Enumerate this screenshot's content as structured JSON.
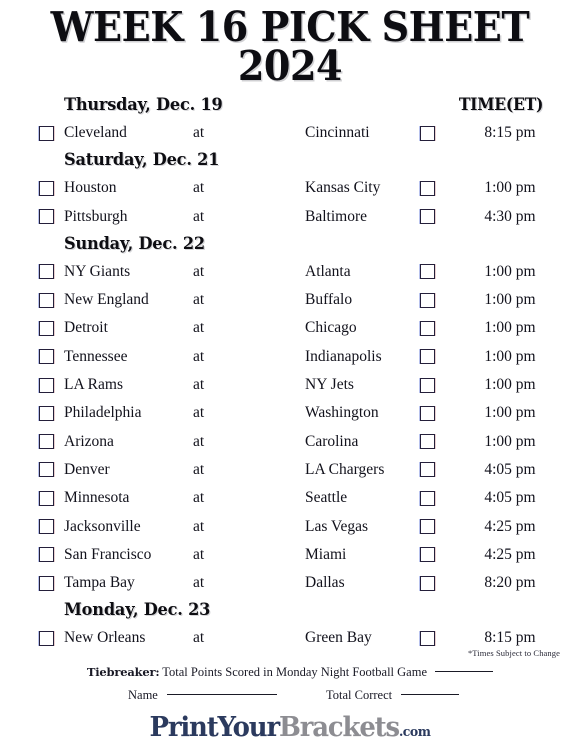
{
  "title": {
    "line1": "WEEK 16 PICK SHEET",
    "line2": "2024"
  },
  "columns": {
    "at_label": "at",
    "time_header": "TIME(ET)"
  },
  "sections": [
    {
      "day": "Thursday, Dec. 19",
      "show_time_header": true,
      "games": [
        {
          "away": "Cleveland",
          "at": "at",
          "home": "Cincinnati",
          "time": "8:15 pm"
        }
      ]
    },
    {
      "day": "Saturday, Dec. 21",
      "show_time_header": false,
      "games": [
        {
          "away": "Houston",
          "at": "at",
          "home": "Kansas City",
          "time": "1:00 pm"
        },
        {
          "away": "Pittsburgh",
          "at": "at",
          "home": "Baltimore",
          "time": "4:30 pm"
        }
      ]
    },
    {
      "day": "Sunday, Dec. 22",
      "show_time_header": false,
      "games": [
        {
          "away": "NY Giants",
          "at": "at",
          "home": "Atlanta",
          "time": "1:00 pm"
        },
        {
          "away": "New England",
          "at": "at",
          "home": "Buffalo",
          "time": "1:00 pm"
        },
        {
          "away": "Detroit",
          "at": "at",
          "home": "Chicago",
          "time": "1:00 pm"
        },
        {
          "away": "Tennessee",
          "at": "at",
          "home": "Indianapolis",
          "time": "1:00 pm"
        },
        {
          "away": "LA Rams",
          "at": "at",
          "home": "NY Jets",
          "time": "1:00 pm"
        },
        {
          "away": "Philadelphia",
          "at": "at",
          "home": "Washington",
          "time": "1:00 pm"
        },
        {
          "away": "Arizona",
          "at": "at",
          "home": "Carolina",
          "time": "1:00 pm"
        },
        {
          "away": "Denver",
          "at": "at",
          "home": "LA Chargers",
          "time": "4:05 pm"
        },
        {
          "away": "Minnesota",
          "at": "at",
          "home": "Seattle",
          "time": "4:05 pm"
        },
        {
          "away": "Jacksonville",
          "at": "at",
          "home": "Las Vegas",
          "time": "4:25 pm"
        },
        {
          "away": "San Francisco",
          "at": "at",
          "home": "Miami",
          "time": "4:25 pm"
        },
        {
          "away": "Tampa Bay",
          "at": "at",
          "home": "Dallas",
          "time": "8:20 pm"
        }
      ]
    },
    {
      "day": "Monday, Dec. 23",
      "show_time_header": false,
      "games": [
        {
          "away": "New Orleans",
          "at": "at",
          "home": "Green Bay",
          "time": "8:15 pm"
        }
      ]
    }
  ],
  "footer": {
    "times_note": "*Times Subject to Change",
    "tiebreaker_label": "Tiebreaker:",
    "tiebreaker_text": "Total Points Scored in Monday Night Football Game",
    "name_label": "Name",
    "total_correct_label": "Total Correct",
    "logo": {
      "part1": "PrintYour",
      "part2": "Brackets",
      "part3": ".com"
    }
  },
  "colors": {
    "ink": "#12121c",
    "checkbox_border": "#241f3a",
    "logo_navy": "#2b3a5e",
    "logo_gray": "#8d8d92"
  }
}
